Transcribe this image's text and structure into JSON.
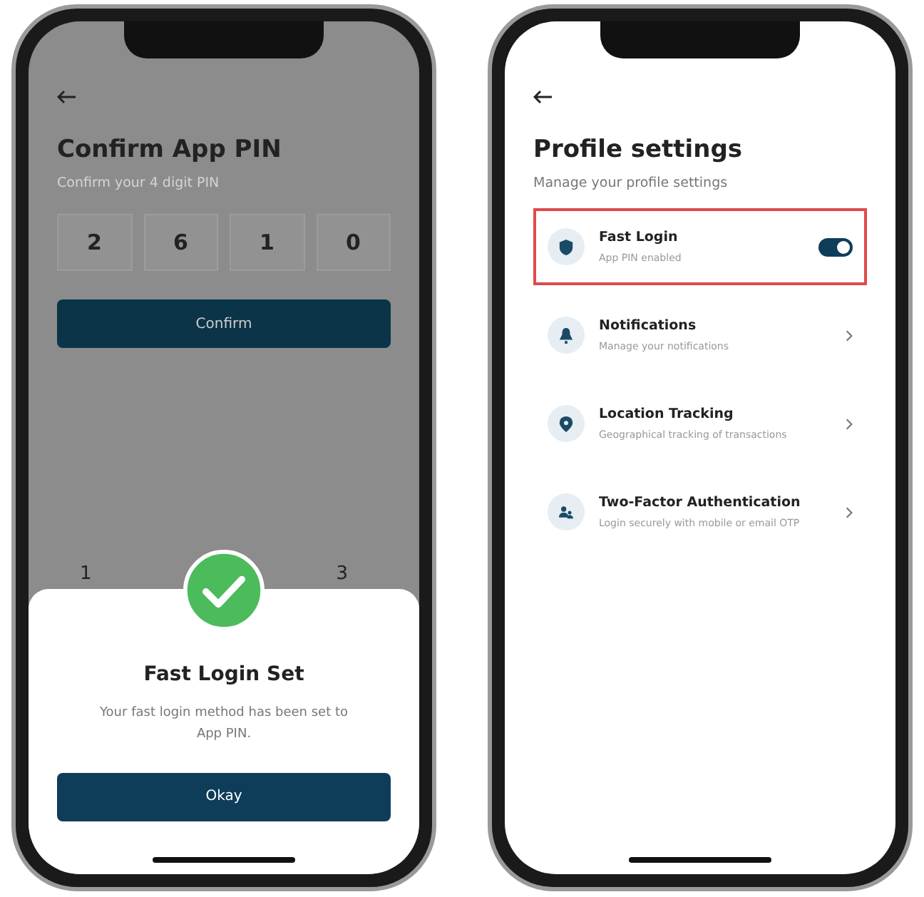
{
  "pin_screen": {
    "title": "Confirm App PIN",
    "subtitle": "Confirm your 4 digit PIN",
    "digits": [
      "2",
      "6",
      "1",
      "0"
    ],
    "confirm_button": "Confirm",
    "keypad_keys": [
      "1",
      "3"
    ],
    "dialog": {
      "title": "Fast Login Set",
      "message": "Your fast login method has been set to App PIN.",
      "button": "Okay"
    }
  },
  "settings_screen": {
    "title": "Profile settings",
    "subtitle": "Manage your profile settings",
    "items": [
      {
        "kind": "toggle",
        "title": "Fast Login",
        "subtitle": "App PIN enabled",
        "on": true,
        "highlighted": true
      },
      {
        "kind": "link",
        "title": "Notifications",
        "subtitle": "Manage your notifications",
        "highlighted": false
      },
      {
        "kind": "link",
        "title": "Location Tracking",
        "subtitle": "Geographical tracking of transactions",
        "highlighted": false
      },
      {
        "kind": "link",
        "title": "Two-Factor Authentication",
        "subtitle": "Login securely with mobile or email OTP",
        "highlighted": false
      }
    ]
  }
}
